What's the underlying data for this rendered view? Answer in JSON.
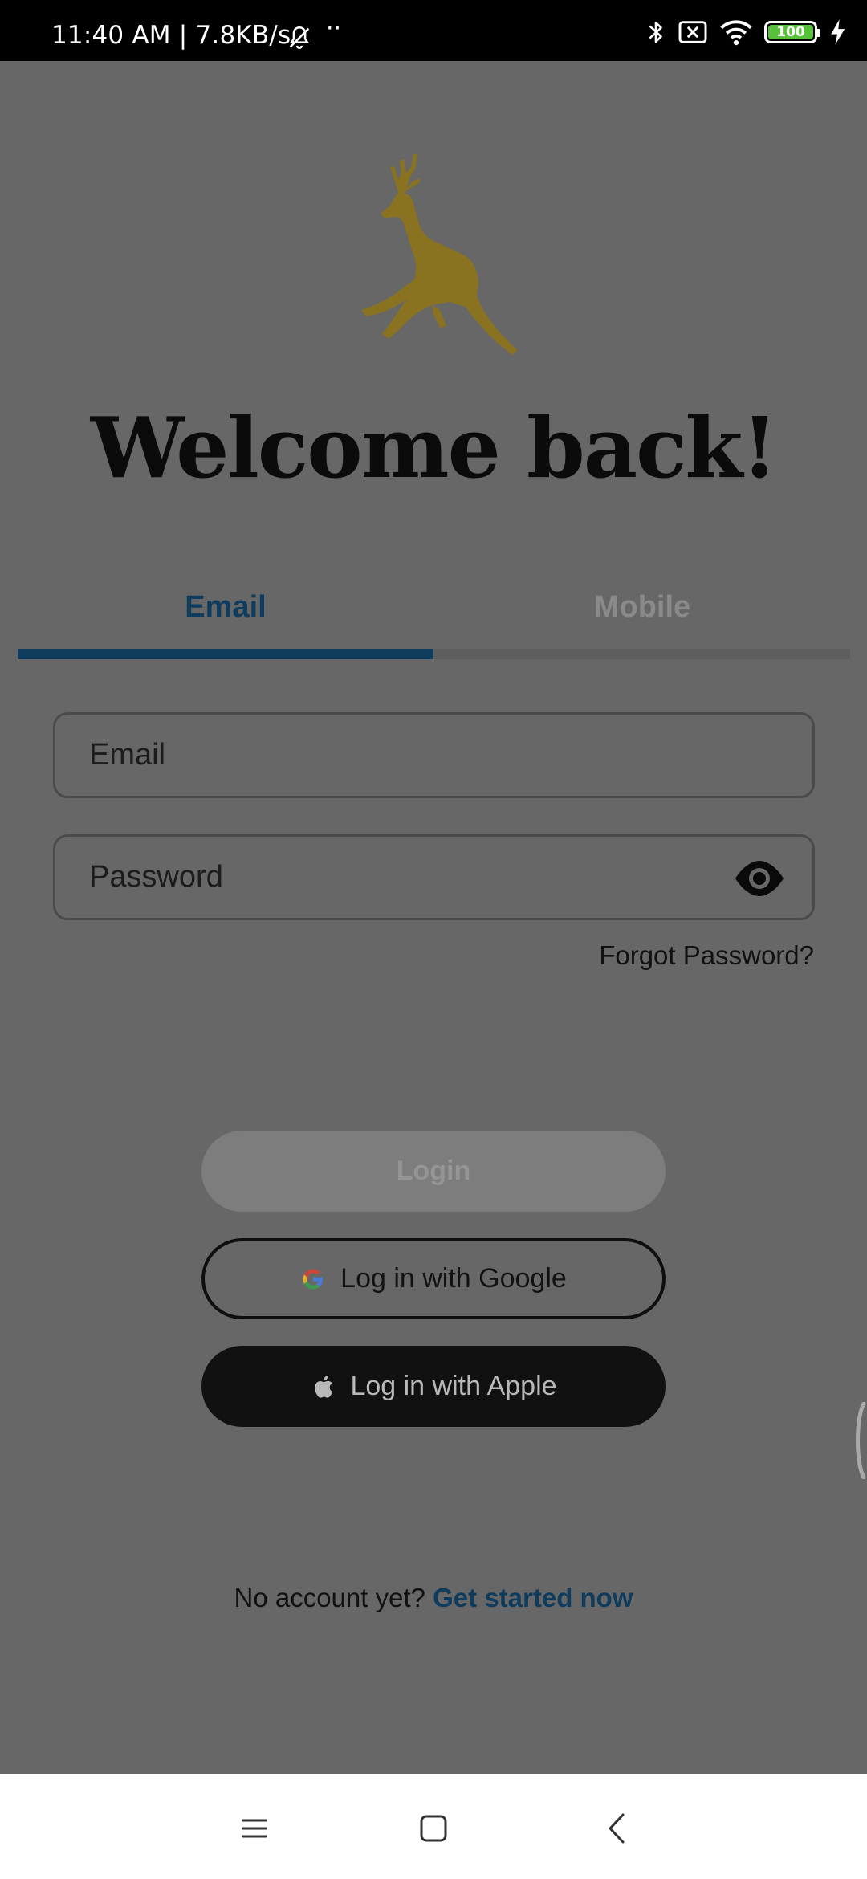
{
  "status_bar": {
    "time": "11:40 AM | 7.8KB/s",
    "battery": "100",
    "icons": [
      "bell-off-icon",
      "bluetooth-icon",
      "sim-off-icon",
      "wifi-icon",
      "battery-icon",
      "charging-icon"
    ]
  },
  "login": {
    "logo": "deer-logo",
    "title": "Welcome back!",
    "tabs": [
      {
        "label": "Email",
        "active": true
      },
      {
        "label": "Mobile",
        "active": false
      }
    ],
    "email_placeholder": "Email",
    "password_placeholder": "Password",
    "forgot_password": "Forgot Password?",
    "login_button": "Login",
    "google_button": "Log in with Google",
    "apple_button": "Log in with Apple",
    "no_account_text": "No account yet?",
    "get_started_link": "Get started now"
  },
  "colors": {
    "accent": "#0f3b5c",
    "logo": "#8a7320",
    "overlay": "#676767"
  },
  "nav_bar": {
    "buttons": [
      "menu-icon",
      "home-icon",
      "back-icon"
    ]
  }
}
